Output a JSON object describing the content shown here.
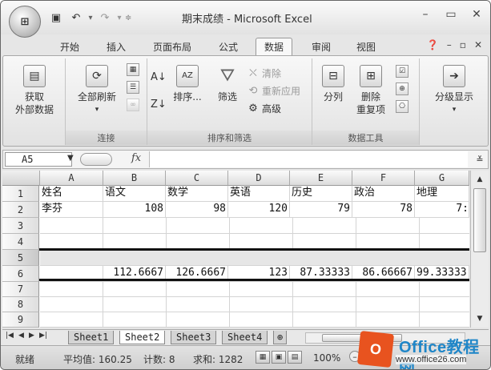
{
  "window": {
    "title": "期末成绩 - Microsoft Excel",
    "office_button_label": "Office"
  },
  "ribbon_tabs": [
    "开始",
    "插入",
    "页面布局",
    "公式",
    "数据",
    "审阅",
    "视图"
  ],
  "active_tab": "数据",
  "groups": {
    "connections": {
      "label": "连接",
      "get_external": "获取\n外部数据",
      "refresh_all": "全部刷新"
    },
    "sort_filter": {
      "label": "排序和筛选",
      "sort": "排序...",
      "filter": "筛选",
      "clear": "清除",
      "reapply": "重新应用",
      "advanced": "高级"
    },
    "data_tools": {
      "label": "数据工具",
      "text_to_columns": "分列",
      "remove_duplicates": "删除\n重复项"
    },
    "outline": {
      "show_outline": "分级显示"
    }
  },
  "formula_bar": {
    "name_box": "A5",
    "fx_label": "fx",
    "formula": ""
  },
  "grid": {
    "columns": [
      "A",
      "B",
      "C",
      "D",
      "E",
      "F",
      "G"
    ],
    "row_numbers": [
      "1",
      "2",
      "3",
      "4",
      "5",
      "6",
      "7",
      "8",
      "9"
    ],
    "rows": {
      "r1": [
        "姓名",
        "语文",
        "数学",
        "英语",
        "历史",
        "政治",
        "地理"
      ],
      "r2": [
        "李芬",
        "108",
        "98",
        "120",
        "79",
        "78",
        "7:"
      ],
      "r6": [
        "",
        "112.6667",
        "126.6667",
        "123",
        "87.33333",
        "86.66667",
        "99.33333"
      ]
    }
  },
  "sheets": [
    "Sheet1",
    "Sheet2",
    "Sheet3",
    "Sheet4"
  ],
  "active_sheet": "Sheet2",
  "status": {
    "ready": "就绪",
    "average": "平均值: 160.25",
    "count": "计数: 8",
    "sum": "求和: 1282",
    "zoom": "100%"
  },
  "watermark": {
    "logo_letter": "O",
    "title": "Office教程网",
    "url": "www.office26.com"
  }
}
